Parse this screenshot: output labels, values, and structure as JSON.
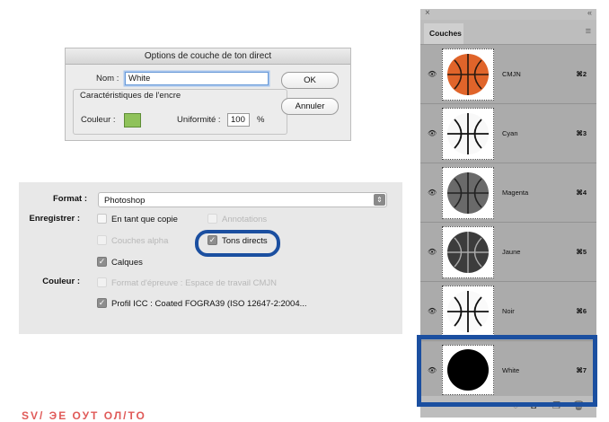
{
  "spot_dialog": {
    "title": "Options de couche de ton direct",
    "name_label": "Nom :",
    "name_value": "White",
    "ink_group_label": "Caractéristiques de l'encre",
    "color_label": "Couleur :",
    "color_swatch": "#8fc25a",
    "solidity_label": "Uniformité :",
    "solidity_value": "100",
    "solidity_unit": "%",
    "ok_label": "OK",
    "cancel_label": "Annuler"
  },
  "save_options": {
    "format_label": "Format :",
    "format_value": "Photoshop",
    "save_label": "Enregistrer :",
    "as_copy": {
      "label": "En tant que copie",
      "checked": false,
      "enabled": true
    },
    "annotations": {
      "label": "Annotations",
      "checked": false,
      "enabled": false
    },
    "alpha_channels": {
      "label": "Couches alpha",
      "checked": false,
      "enabled": false
    },
    "spot_colors": {
      "label": "Tons directs",
      "checked": true,
      "enabled": true
    },
    "layers": {
      "label": "Calques",
      "checked": true,
      "enabled": true
    },
    "color_label": "Couleur :",
    "proof_setup": {
      "label": "Format d'épreuve : Espace de travail CMJN",
      "checked": false,
      "enabled": false
    },
    "icc_profile": {
      "label": "Profil ICC : Coated FOGRA39 (ISO 12647-2:2004...",
      "checked": true,
      "enabled": true
    }
  },
  "channels_panel": {
    "close_glyph": "×",
    "collapse_glyph": "«",
    "tab_label": "Couches",
    "menu_glyph": "≡",
    "channels": [
      {
        "name": "CMJN",
        "shortcut": "⌘2"
      },
      {
        "name": "Cyan",
        "shortcut": "⌘3"
      },
      {
        "name": "Magenta",
        "shortcut": "⌘4"
      },
      {
        "name": "Jaune",
        "shortcut": "⌘5"
      },
      {
        "name": "Noir",
        "shortcut": "⌘6"
      },
      {
        "name": "White",
        "shortcut": "⌘7"
      }
    ],
    "highlight_color": "#1b4fa0"
  },
  "bottom_text": "SV/ ЭЕ ОУТ ОЛ/ТО"
}
